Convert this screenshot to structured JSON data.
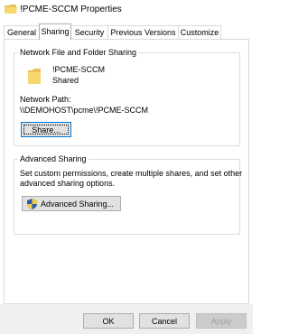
{
  "window": {
    "title": "!PCME-SCCM Properties"
  },
  "tabs": [
    {
      "label": "General",
      "active": false
    },
    {
      "label": "Sharing",
      "active": true
    },
    {
      "label": "Security",
      "active": false
    },
    {
      "label": "Previous Versions",
      "active": false
    },
    {
      "label": "Customize",
      "active": false
    }
  ],
  "network_sharing": {
    "group_label": "Network File and Folder Sharing",
    "folder_name": "!PCME-SCCM",
    "status": "Shared",
    "path_label": "Network Path:",
    "path_value": "\\\\DEMOHOST\\pcme\\!PCME-SCCM",
    "share_button": "Share..."
  },
  "advanced_sharing": {
    "group_label": "Advanced Sharing",
    "description_line1": "Set custom permissions, create multiple shares, and set other",
    "description_line2": "advanced sharing options.",
    "button": "Advanced Sharing..."
  },
  "footer": {
    "ok": "OK",
    "cancel": "Cancel",
    "apply": "Apply"
  },
  "icons": {
    "title": "folder-icon",
    "folder": "folder-icon",
    "shield": "uac-shield-icon"
  },
  "colors": {
    "focus_border": "#0078d7",
    "folder_yellow": "#f5d76e",
    "button_face": "#e1e1e1",
    "disabled_text": "#a0a0a0"
  }
}
